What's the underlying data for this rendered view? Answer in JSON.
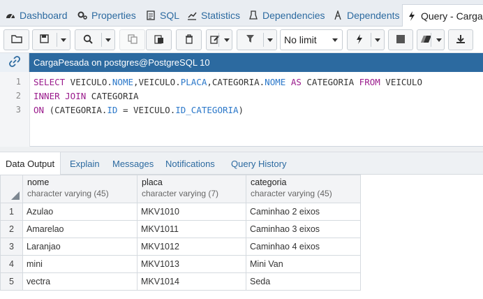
{
  "top_tabs": [
    {
      "label": "Dashboard",
      "icon": "dashboard-icon"
    },
    {
      "label": "Properties",
      "icon": "properties-icon"
    },
    {
      "label": "SQL",
      "icon": "sql-icon"
    },
    {
      "label": "Statistics",
      "icon": "statistics-icon"
    },
    {
      "label": "Dependencies",
      "icon": "dependencies-icon"
    },
    {
      "label": "Dependents",
      "icon": "dependents-icon"
    },
    {
      "label": "Query - CargaPe",
      "icon": "query-bolt-icon"
    }
  ],
  "toolbar": {
    "limit_value": "No limit"
  },
  "connection": {
    "title": "CargaPesada on postgres@PostgreSQL 10"
  },
  "editor": {
    "line_numbers": [
      "1",
      "2",
      "3"
    ]
  },
  "output_tabs": [
    {
      "label": "Data Output"
    },
    {
      "label": "Explain"
    },
    {
      "label": "Messages"
    },
    {
      "label": "Notifications"
    },
    {
      "label": "Query History"
    }
  ],
  "grid": {
    "columns": [
      {
        "name": "nome",
        "type": "character varying (45)"
      },
      {
        "name": "placa",
        "type": "character varying (7)"
      },
      {
        "name": "categoria",
        "type": "character varying (45)"
      }
    ],
    "rows": [
      {
        "n": "1",
        "nome": "Azulao",
        "placa": "MKV1010",
        "categoria": "Caminhao 2 eixos"
      },
      {
        "n": "2",
        "nome": "Amarelao",
        "placa": "MKV1011",
        "categoria": "Caminhao 3 eixos"
      },
      {
        "n": "3",
        "nome": "Laranjao",
        "placa": "MKV1012",
        "categoria": "Caminhao 4 eixos"
      },
      {
        "n": "4",
        "nome": "mini",
        "placa": "MKV1013",
        "categoria": "Mini Van"
      },
      {
        "n": "5",
        "nome": "vectra",
        "placa": "MKV1014",
        "categoria": "Seda"
      }
    ]
  },
  "colors": {
    "accent": "#2c6aa0",
    "keyword": "#9a1b8c",
    "field": "#2a77c9"
  }
}
